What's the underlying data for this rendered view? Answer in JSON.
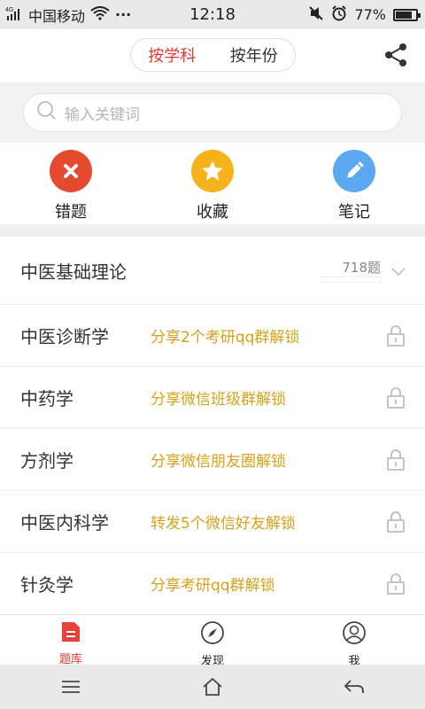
{
  "status_bar": {
    "network": "4G",
    "carrier": "中国移动",
    "dots": "···",
    "time": "12:18",
    "battery": "77%",
    "battery_level": 0.77
  },
  "header": {
    "tabs": [
      {
        "label": "按学科",
        "active": true
      },
      {
        "label": "按年份",
        "active": false
      }
    ],
    "share_icon": "share-icon"
  },
  "search": {
    "placeholder": "输入关键词"
  },
  "actions": [
    {
      "label": "错题",
      "icon": "close-icon",
      "color": "#e64a2e"
    },
    {
      "label": "收藏",
      "icon": "star-icon",
      "color": "#f5b21b"
    },
    {
      "label": "笔记",
      "icon": "pencil-icon",
      "color": "#5aa8f0"
    }
  ],
  "subjects": [
    {
      "name": "中医基础理论",
      "count": "718题"
    },
    {
      "name": "中医诊断学",
      "hint": "分享2个考研qq群解锁"
    },
    {
      "name": "中药学",
      "hint": "分享微信班级群解锁"
    },
    {
      "name": "方剂学",
      "hint": "分享微信朋友圈解锁"
    },
    {
      "name": "中医内科学",
      "hint": "转发5个微信好友解锁"
    },
    {
      "name": "针灸学",
      "hint": "分享考研qq群解锁"
    }
  ],
  "bottom_nav": [
    {
      "label": "题库",
      "icon": "question-bank-icon",
      "active": true
    },
    {
      "label": "发现",
      "icon": "compass-icon",
      "active": false
    },
    {
      "label": "我",
      "icon": "profile-icon",
      "active": false
    }
  ],
  "colors": {
    "accent": "#e03b33",
    "hint": "#d6a21a"
  }
}
